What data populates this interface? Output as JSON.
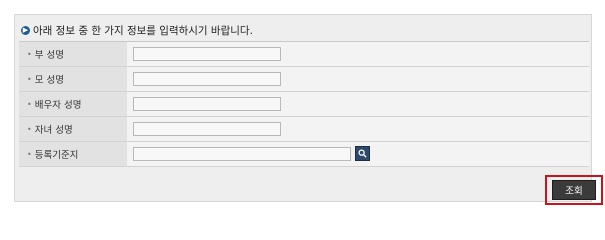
{
  "heading": {
    "icon": "arrow-bullet-icon",
    "text": "아래 정보 중 한 가지 정보를 입력하시기 바랍니다."
  },
  "fields": [
    {
      "label": "부 성명",
      "value": ""
    },
    {
      "label": "모 성명",
      "value": ""
    },
    {
      "label": "배우자 성명",
      "value": ""
    },
    {
      "label": "자녀 성명",
      "value": ""
    },
    {
      "label": "등록기준지",
      "value": ""
    }
  ],
  "bullet": "•",
  "search_button": {
    "icon": "search-icon"
  },
  "submit": {
    "label": "조회"
  },
  "colors": {
    "highlight_border": "#c8141c",
    "submit_bg": "#3b3b3b",
    "search_bg": "#2e4a6b"
  }
}
